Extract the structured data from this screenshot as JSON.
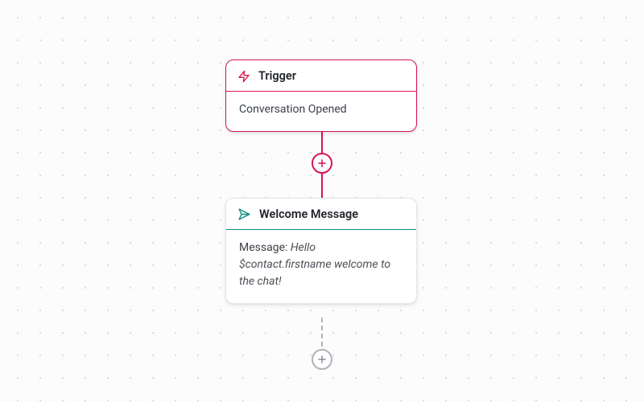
{
  "colors": {
    "trigger": "#d6154f",
    "action_accent": "#0f8e7e",
    "muted": "#aeb4bc"
  },
  "nodes": {
    "trigger": {
      "title": "Trigger",
      "body": "Conversation Opened"
    },
    "action": {
      "title": "Welcome Message",
      "message_label": "Message: ",
      "message_value": "Hello $contact.firstname welcome to the chat!"
    }
  }
}
